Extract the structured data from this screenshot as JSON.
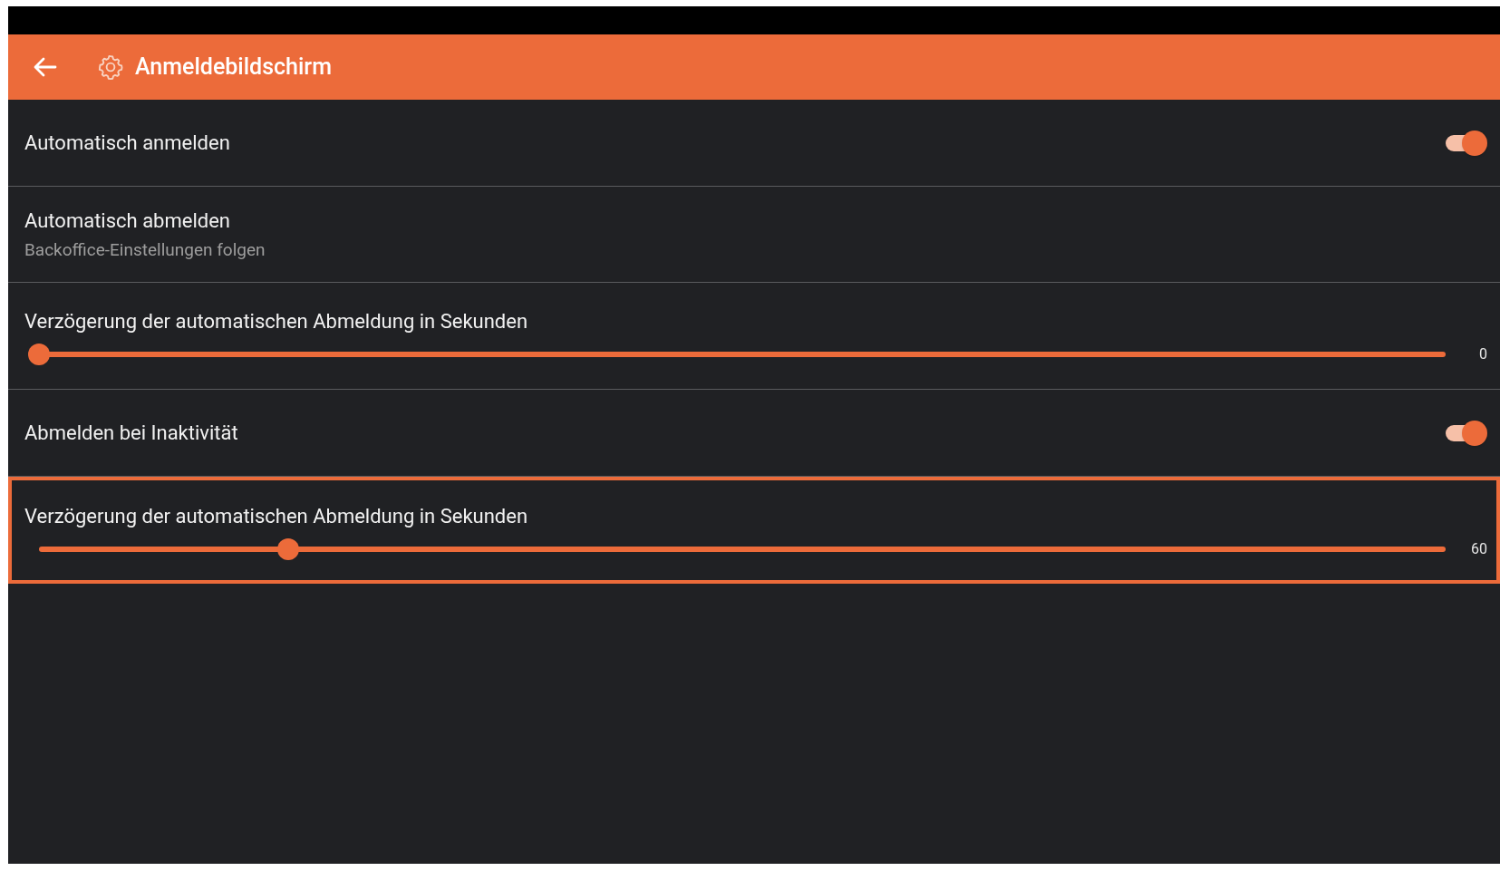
{
  "header": {
    "title": "Anmeldebildschirm"
  },
  "rows": [
    {
      "kind": "toggle",
      "label": "Automatisch anmelden",
      "on": true,
      "focused": false
    },
    {
      "kind": "info",
      "label": "Automatisch abmelden",
      "summary": "Backoffice-Einstellungen folgen",
      "focused": false
    },
    {
      "kind": "slider",
      "label": "Verzögerung der automatischen Abmeldung in Sekunden",
      "level": 0,
      "reading": "0",
      "focused": false
    },
    {
      "kind": "toggle",
      "label": "Abmelden bei Inaktivität",
      "on": true,
      "focused": false
    },
    {
      "kind": "slider",
      "label": "Verzögerung der automatischen Abmeldung in Sekunden",
      "level": 0.177,
      "reading": "60",
      "focused": true
    }
  ]
}
